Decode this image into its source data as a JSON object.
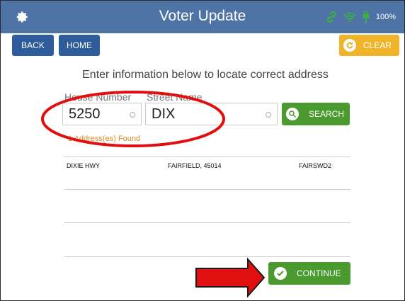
{
  "app": {
    "title": "Voter Update"
  },
  "status": {
    "battery": "100%"
  },
  "toolbar": {
    "back_label": "BACK",
    "home_label": "HOME",
    "clear_label": "CLEAR"
  },
  "form": {
    "instruction": "Enter information below to locate correct address",
    "house_number_label": "House Number",
    "house_number_value": "5250",
    "street_name_label": "Street Name",
    "street_name_value": "DIX",
    "search_label": "SEARCH"
  },
  "results": {
    "count_text": "1 Address(es) Found",
    "rows": [
      {
        "street": "DIXIE HWY",
        "city": "FAIRFIELD, 45014",
        "precinct": "FAIRSWD2"
      }
    ]
  },
  "footer": {
    "continue_label": "CONTINUE"
  },
  "colors": {
    "header": "#4e74a6",
    "primary": "#2f5d9c",
    "success": "#4a9a2f",
    "warning": "#f0b428",
    "annotation": "#e01010"
  },
  "icons": {
    "settings": "gear-icon",
    "link": "link-icon",
    "wifi": "wifi-icon",
    "power": "plug-icon",
    "clear": "refresh-icon",
    "search": "search-icon",
    "continue": "checkmark-icon"
  }
}
